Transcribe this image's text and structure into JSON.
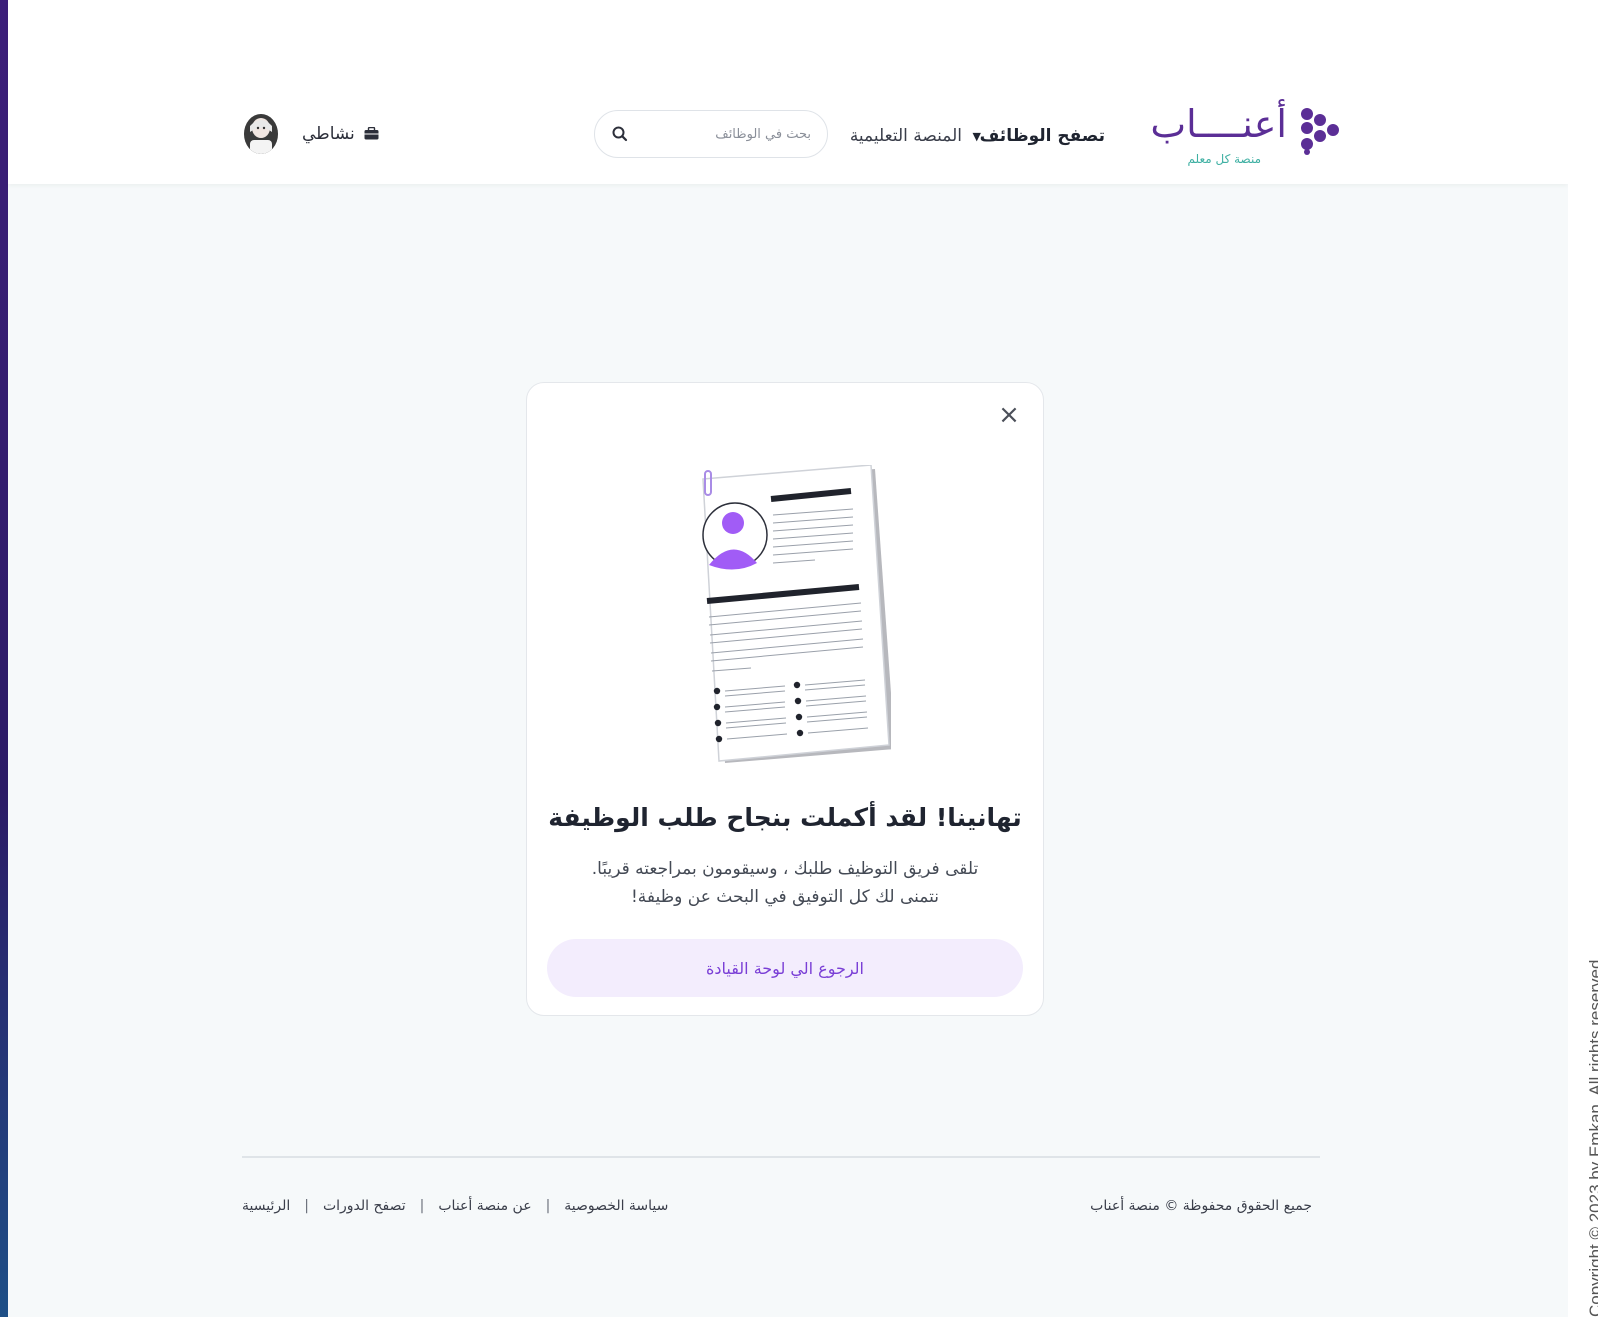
{
  "brand": {
    "name": "أعنــــاب",
    "tagline": "منصة كل معلم",
    "primary_color": "#5b2e96",
    "accent_color": "#3fb0a3"
  },
  "nav": {
    "browse_jobs": "تصفح الوظائف",
    "platform": "المنصة التعليمية",
    "search_placeholder": "بحث في الوظائف",
    "activity": "نشاطي"
  },
  "modal": {
    "title": "تهانينا! لقد أكملت بنجاح طلب الوظيفة",
    "line1": "تلقى فريق التوظيف طلبك ، وسيقومون بمراجعته قريبًا.",
    "line2": "نتمنى لك كل التوفيق في البحث عن وظيفة!",
    "button": "الرجوع الي لوحة القيادة",
    "close": "×",
    "button_color": "#f3edfd",
    "button_text_color": "#7a3fd6"
  },
  "footer": {
    "copyright": "جميع الحقوق محفوظة © منصة أعناب",
    "links": [
      "الرئيسية",
      "تصفح الدورات",
      "عن منصة أعناب",
      "سياسة الخصوصية"
    ]
  },
  "side_copyright": "Copyright © 2023 by Emkan. All rights reserved."
}
